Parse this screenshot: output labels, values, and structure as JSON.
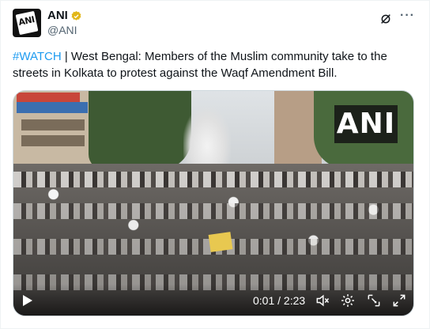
{
  "account": {
    "display_name": "ANI",
    "handle": "@ANI",
    "avatar_text": "ANI"
  },
  "tweet": {
    "hashtag": "#WATCH",
    "body": " | West Bengal: Members of the Muslim community take to the streets in Kolkata to protest against the Waqf Amendment Bill."
  },
  "media": {
    "watermark": "ANI",
    "time_current": "0:01",
    "time_separator": " / ",
    "time_total": "2:23"
  },
  "icons": {
    "verified": "verified-badge-icon",
    "grok": "grok-icon",
    "more": "more-icon",
    "play": "play-icon",
    "mute": "mute-icon",
    "settings": "settings-icon",
    "pip": "picture-in-picture-icon",
    "fullscreen": "fullscreen-icon"
  },
  "colors": {
    "link": "#1d9bf0",
    "verified": "#e2b719",
    "text": "#0f1419",
    "muted": "#536471"
  }
}
